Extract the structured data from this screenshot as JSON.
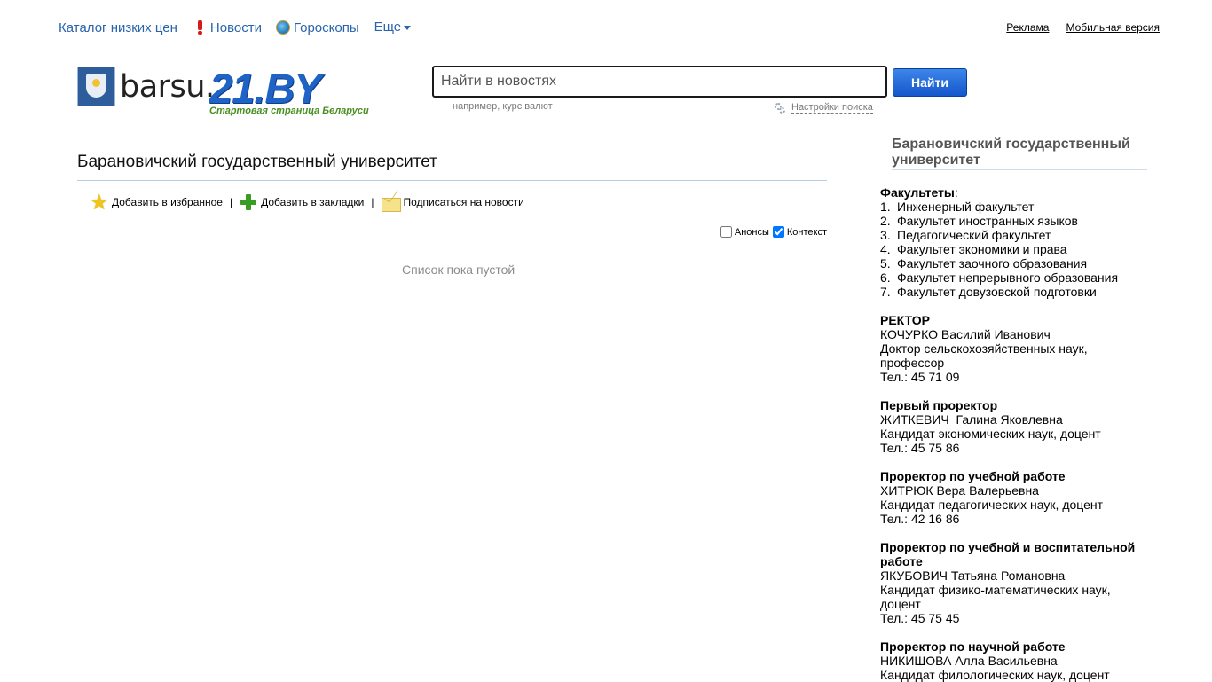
{
  "topnav": {
    "catalog": "Каталог низких цен",
    "news": "Новости",
    "horoscopes": "Гороскопы",
    "more": "Еще"
  },
  "toplinks": {
    "ads": "Реклама",
    "mobile": "Мобильная версия"
  },
  "logo": {
    "barsu": "barsu.",
    "site": "21.BY",
    "slogan": "Стартовая страница Беларуси"
  },
  "search": {
    "placeholder": "Найти в новостях",
    "button": "Найти",
    "hint": "например, курс валют",
    "settings": "Настройки поиска"
  },
  "main": {
    "title": "Барановичский государственный университет",
    "actions": {
      "favorites": "Добавить в избранное",
      "bookmarks": "Добавить в закладки",
      "subscribe": "Подписаться на новости",
      "separator": "|"
    },
    "filters": {
      "announcements": "Анонсы",
      "announcements_checked": false,
      "context": "Контекст",
      "context_checked": true
    },
    "empty": "Список пока пустой"
  },
  "sidebar": {
    "title": "Барановичский государственный университет",
    "faculties_label": "Факультеты",
    "faculties": [
      {
        "num": "1.",
        "name": "Инженерный факультет"
      },
      {
        "num": "2.",
        "name": "Факультет иностранных языков"
      },
      {
        "num": "3.",
        "name": "Педагогический факультет"
      },
      {
        "num": "4.",
        "name": "Факультет экономики и права"
      },
      {
        "num": "5.",
        "name": "Факультет заочного образования"
      },
      {
        "num": "6.",
        "name": "Факультет непрерывного образования"
      },
      {
        "num": "7.",
        "name": "Факультет довузовской подготовки"
      }
    ],
    "people": [
      {
        "role": "РЕКТОР",
        "name": "КОЧУРКО Василий Иванович",
        "degree": "Доктор сельскохозяйственных наук, профессор",
        "phone": "Тел.: 45 71 09"
      },
      {
        "role": "Первый проректор",
        "name": "ЖИТКЕВИЧ  Галина Яковлевна",
        "degree": "Кандидат экономических наук, доцент",
        "phone": "Тел.: 45 75 86"
      },
      {
        "role": "Проректор по учебной работе",
        "name": "ХИТРЮК Вера Валерьевна",
        "degree": "Кандидат педагогических наук, доцент",
        "phone": "Тел.: 42 16 86"
      },
      {
        "role": "Проректор по учебной и воспитательной работе",
        "name": "ЯКУБОВИЧ Татьяна Романовна",
        "degree": "Кандидат физико-математических наук, доцент",
        "phone": "Тел.: 45 75 45"
      },
      {
        "role": "Проректор по научной работе",
        "name": "НИКИШОВА Алла Васильевна",
        "degree": "Кандидат филологических наук, доцент",
        "phone": ""
      }
    ]
  }
}
